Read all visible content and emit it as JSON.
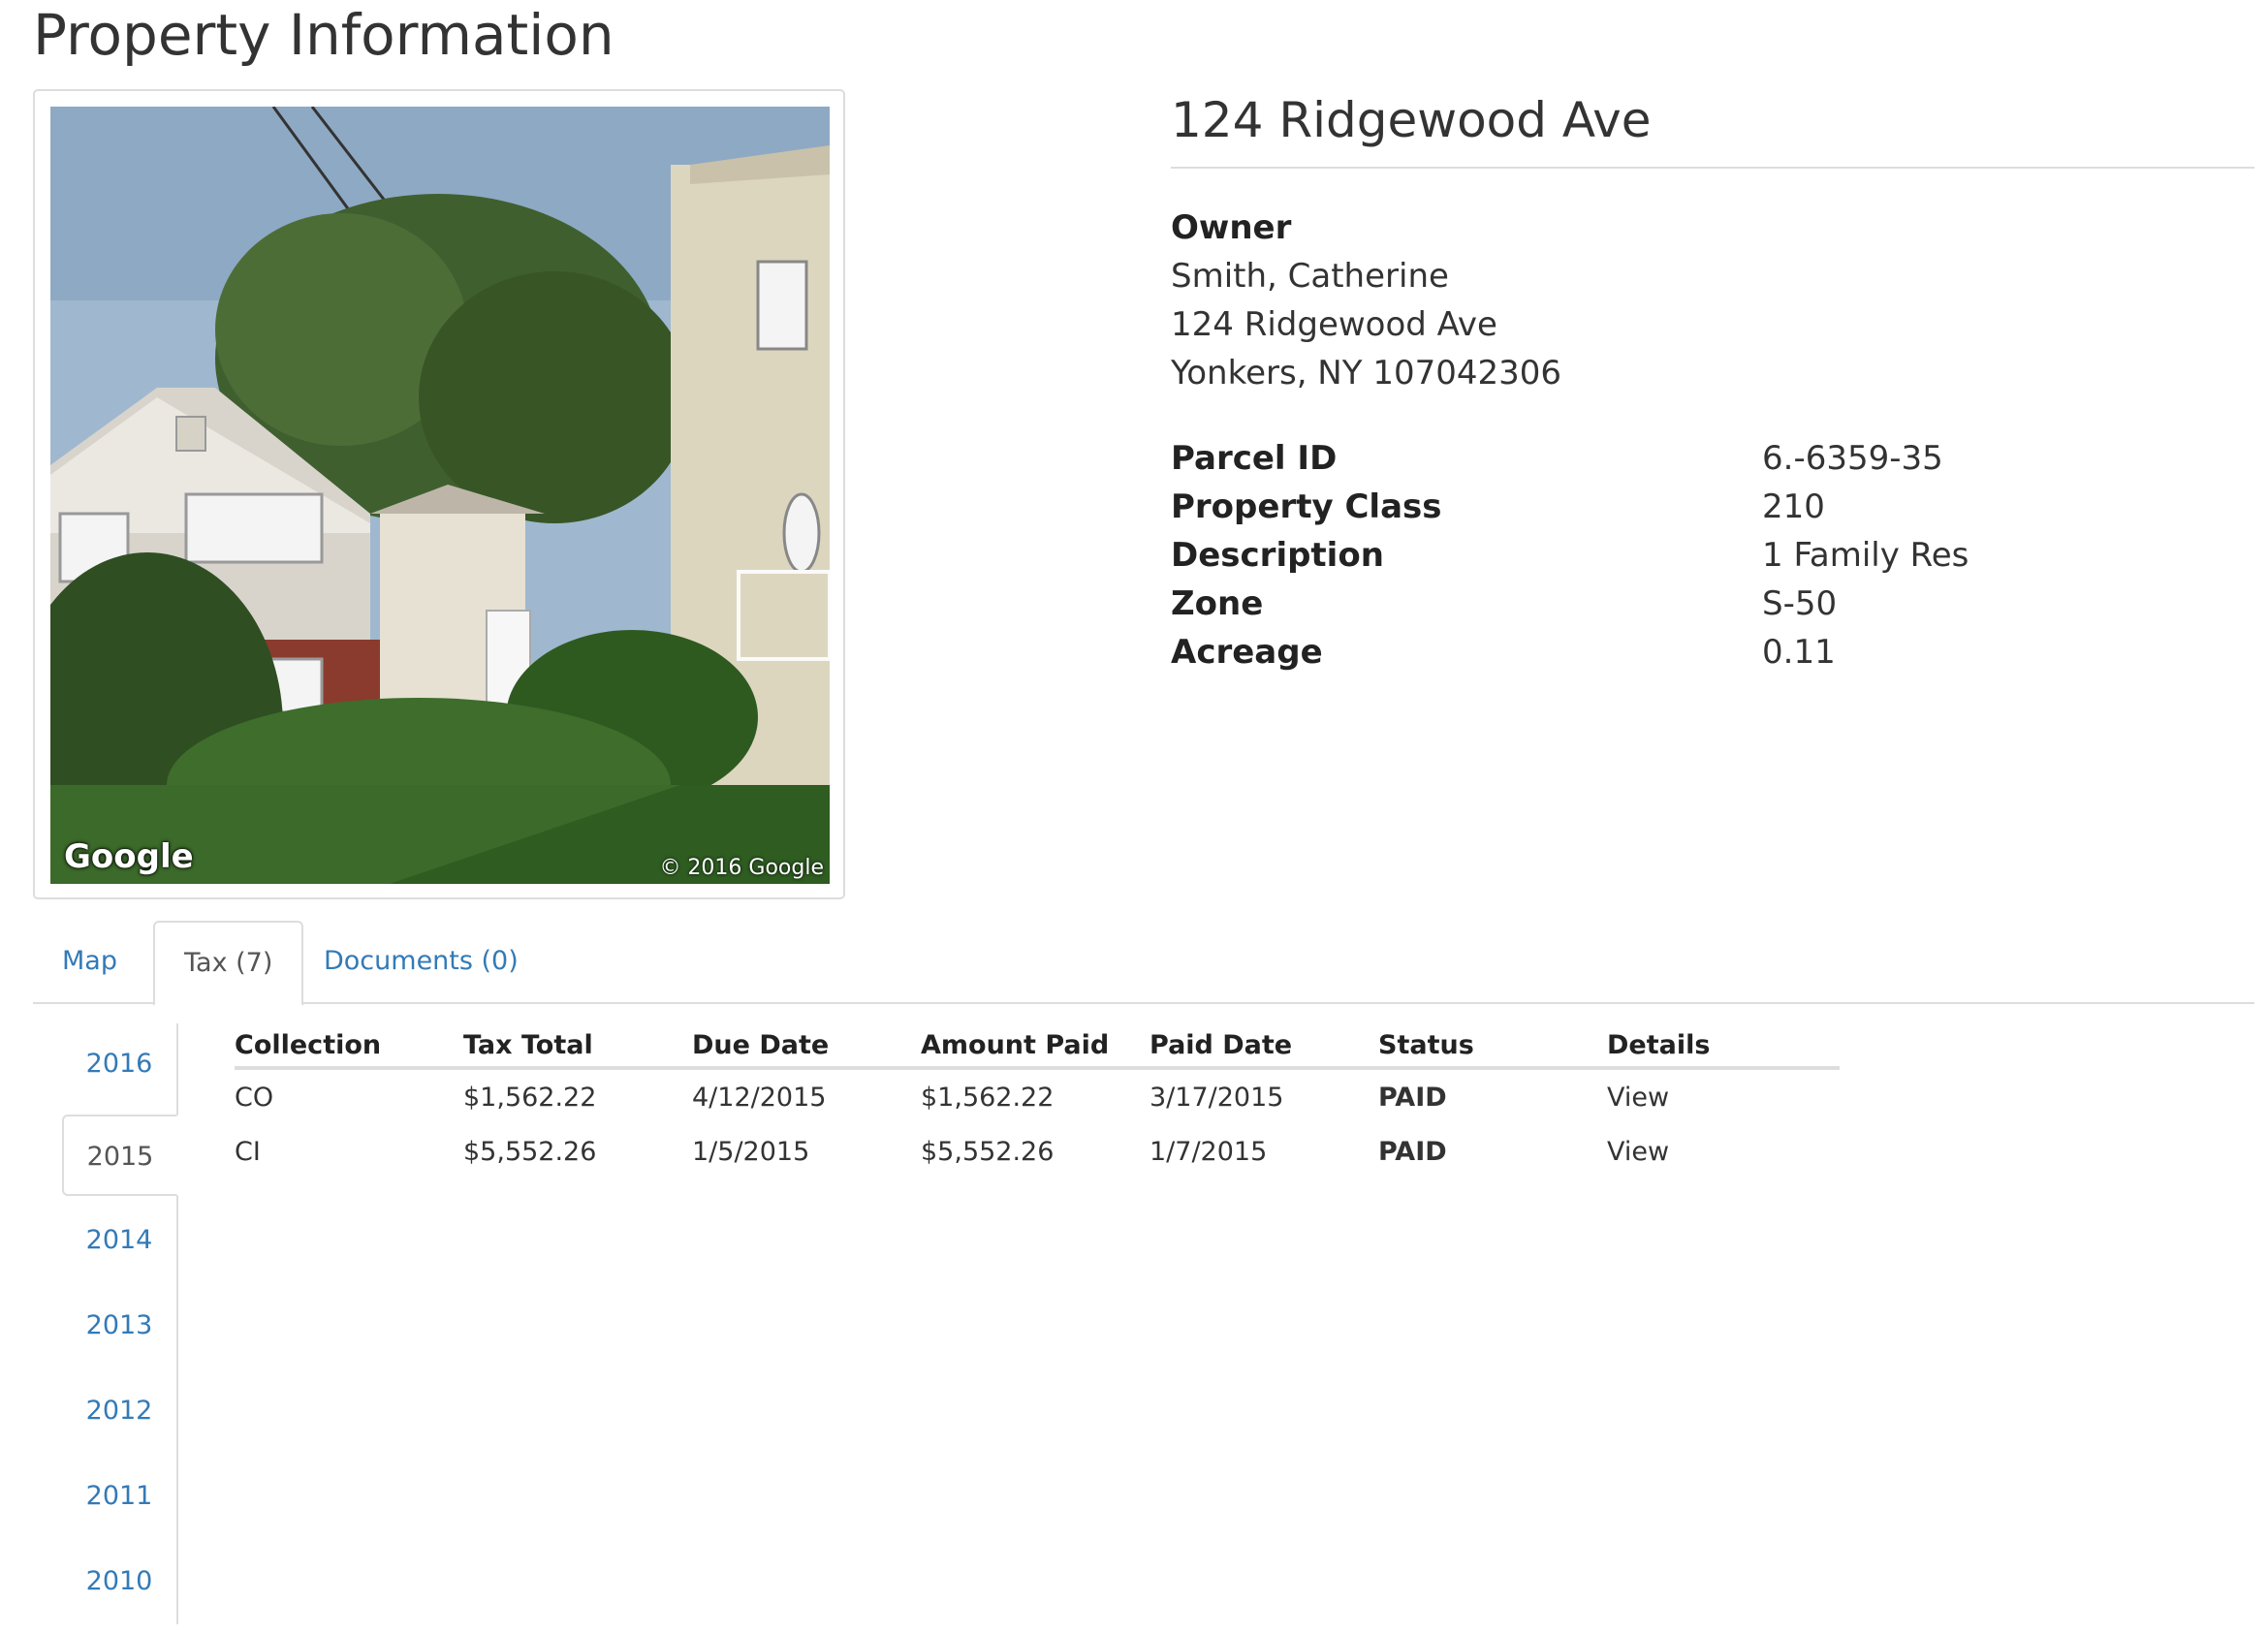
{
  "page": {
    "title": "Property Information"
  },
  "photo": {
    "brand": "Google",
    "copyright": "© 2016 Google"
  },
  "property": {
    "address": "124 Ridgewood Ave",
    "owner_label": "Owner",
    "owner_name": "Smith, Catherine",
    "owner_street": "124 Ridgewood Ave",
    "owner_city": "Yonkers, NY 107042306",
    "fields": [
      {
        "label": "Parcel ID",
        "value": "6.-6359-35"
      },
      {
        "label": "Property Class",
        "value": "210"
      },
      {
        "label": "Description",
        "value": "1 Family Res"
      },
      {
        "label": "Zone",
        "value": "S-50"
      },
      {
        "label": "Acreage",
        "value": "0.11"
      }
    ]
  },
  "tabs": [
    {
      "label": "Map"
    },
    {
      "label": "Tax (7)"
    },
    {
      "label": "Documents (0)"
    }
  ],
  "years": [
    "2016",
    "2015",
    "2014",
    "2013",
    "2012",
    "2011",
    "2010"
  ],
  "tax_table": {
    "headers": [
      "Collection",
      "Tax Total",
      "Due Date",
      "Amount Paid",
      "Paid Date",
      "Status",
      "Details"
    ],
    "rows": [
      {
        "collection": "CO",
        "tax_total": "$1,562.22",
        "due_date": "4/12/2015",
        "amount_paid": "$1,562.22",
        "paid_date": "3/17/2015",
        "status": "PAID",
        "details": "View"
      },
      {
        "collection": "CI",
        "tax_total": "$5,552.26",
        "due_date": "1/5/2015",
        "amount_paid": "$5,552.26",
        "paid_date": "1/7/2015",
        "status": "PAID",
        "details": "View"
      }
    ]
  },
  "colors": {
    "link": "#337ab7",
    "paid": "#22aa22",
    "border": "#dddddd"
  }
}
